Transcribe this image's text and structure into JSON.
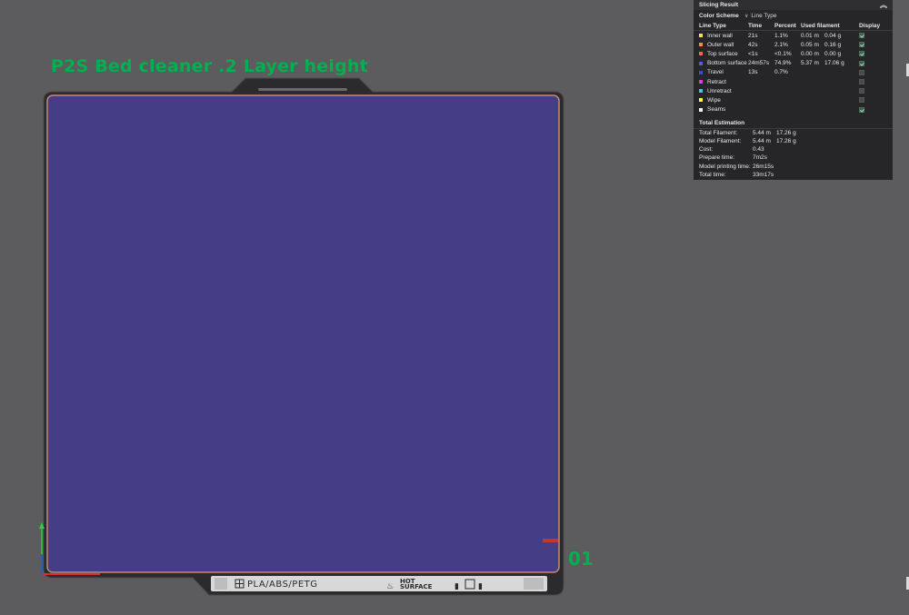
{
  "viewport": {
    "plate_title": "P2S Bed cleaner .2 Layer height",
    "plate_number": "01",
    "bed_material_label": "PLA/ABS/PETG",
    "hot_surface_line1": "HOT",
    "hot_surface_line2": "SURFACE",
    "colors": {
      "bed_fill": "#453d86",
      "bed_outline": "#c98a6a",
      "title_green": "#00b050"
    }
  },
  "panel": {
    "title": "Slicing Result",
    "color_scheme_label": "Color Scheme",
    "color_scheme_value": "Line Type",
    "headers": {
      "line_type": "Line Type",
      "time": "Time",
      "percent": "Percent",
      "used_filament": "Used filament",
      "display": "Display"
    },
    "rows": [
      {
        "name": "Inner wall",
        "time": "21s",
        "percent": "1.1%",
        "meters": "0.01 m",
        "grams": "0.04 g",
        "color": "#ffe44d",
        "display": true
      },
      {
        "name": "Outer wall",
        "time": "42s",
        "percent": "2.1%",
        "meters": "0.05 m",
        "grams": "0.16 g",
        "color": "#ff8c39",
        "display": true
      },
      {
        "name": "Top surface",
        "time": "<1s",
        "percent": "<0.1%",
        "meters": "0.00 m",
        "grams": "0.00 g",
        "color": "#ff5f5f",
        "display": true
      },
      {
        "name": "Bottom surface",
        "time": "24m57s",
        "percent": "74.9%",
        "meters": "5.37 m",
        "grams": "17.06 g",
        "color": "#5a5ad8",
        "display": true
      },
      {
        "name": "Travel",
        "time": "13s",
        "percent": "0.7%",
        "meters": "",
        "grams": "",
        "color": "#3a4ad8",
        "display": false
      },
      {
        "name": "Retract",
        "time": "",
        "percent": "",
        "meters": "",
        "grams": "",
        "color": "#e040c8",
        "display": false
      },
      {
        "name": "Unretract",
        "time": "",
        "percent": "",
        "meters": "",
        "grams": "",
        "color": "#40c8e0",
        "display": false
      },
      {
        "name": "Wipe",
        "time": "",
        "percent": "",
        "meters": "",
        "grams": "",
        "color": "#ffff40",
        "display": false
      },
      {
        "name": "Seams",
        "time": "",
        "percent": "",
        "meters": "",
        "grams": "",
        "color": "#f0f0f0",
        "display": true
      }
    ],
    "estimation_title": "Total Estimation",
    "estimation": [
      {
        "label": "Total Filament:",
        "v1": "5.44 m",
        "v2": "17.26 g"
      },
      {
        "label": "Model Filament:",
        "v1": "5.44 m",
        "v2": "17.26 g"
      },
      {
        "label": "Cost:",
        "v1": "0.43",
        "v2": ""
      },
      {
        "label": "Prepare time:",
        "v1": "7m2s",
        "v2": ""
      },
      {
        "label": "Model printing time:",
        "v1": "26m15s",
        "v2": ""
      },
      {
        "label": "Total time:",
        "v1": "33m17s",
        "v2": ""
      }
    ]
  }
}
